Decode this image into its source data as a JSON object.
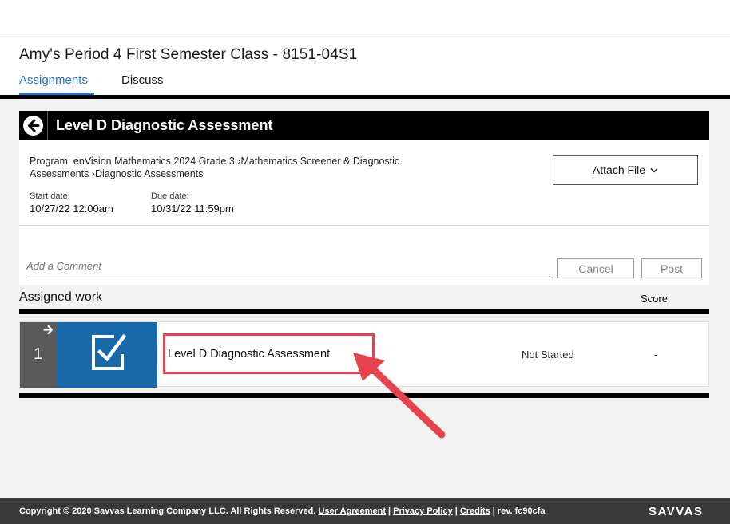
{
  "class": {
    "title": "Amy's Period 4 First Semester Class - 8151-04S1",
    "tabs": [
      {
        "label": "Assignments",
        "active": true
      },
      {
        "label": "Discuss",
        "active": false
      }
    ]
  },
  "assignment": {
    "title": "Level D Diagnostic Assessment",
    "program": "Program: enVision Mathematics 2024 Grade 3 ›Mathematics Screener & Diagnostic Assessments ›Diagnostic Assessments",
    "start_label": "Start date:",
    "start_value": "10/27/22 12:00am",
    "due_label": "Due date:",
    "due_value": "10/31/22 11:59pm",
    "attach_label": "Attach File"
  },
  "comment": {
    "placeholder": "Add a Comment",
    "cancel_label": "Cancel",
    "post_label": "Post"
  },
  "work": {
    "heading": "Assigned work",
    "score_heading": "Score",
    "items": [
      {
        "number": "1",
        "title": "Level D Diagnostic Assessment",
        "status": "Not Started",
        "score": "-"
      }
    ]
  },
  "footer": {
    "copyright": "Copyright © 2020 Savvas Learning Company LLC. All Rights Reserved.",
    "links": [
      "User Agreement",
      "Privacy Policy",
      "Credits"
    ],
    "rev": "rev. fc90cfa",
    "brand": "SAVVAS"
  },
  "colors": {
    "accent": "#1f73c9",
    "tile": "#1769aa",
    "highlight": "#e8424d"
  }
}
